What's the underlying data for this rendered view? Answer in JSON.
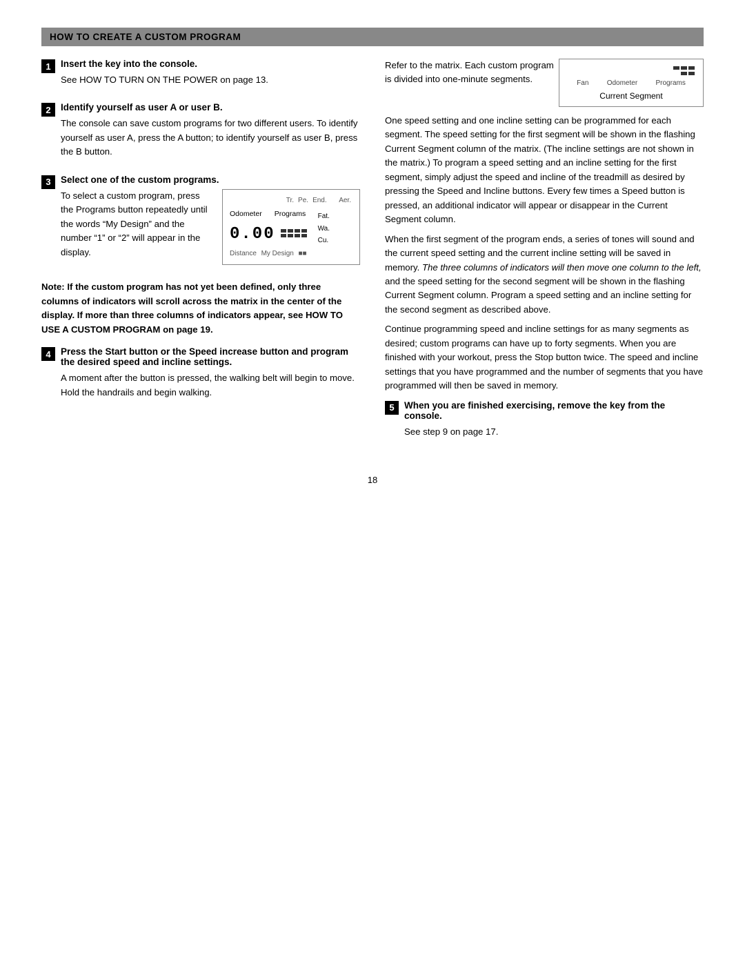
{
  "header": {
    "title": "HOW TO CREATE A CUSTOM PROGRAM"
  },
  "left_col": {
    "steps": [
      {
        "number": "1",
        "title": "Insert the key into the console.",
        "body": "See HOW TO TURN ON THE POWER on page 13."
      },
      {
        "number": "2",
        "title": "Identify yourself as user A or user B.",
        "body": "The console can save custom programs for two different users. To identify yourself as user A, press the A button; to identify yourself as user B, press the B button."
      },
      {
        "number": "3",
        "title": "Select one of the custom programs.",
        "body_intro": "To select a custom program, press the Programs button repeatedly until the words “My Design” and the number “1” or “2” will appear in the display.",
        "display": {
          "top_labels": [
            "Tr.",
            "Pe.",
            "End."
          ],
          "left_labels": [
            "Odometer",
            "Programs"
          ],
          "number": "0.00",
          "bottom_left": "Distance",
          "bottom_center": "My Design",
          "bottom_right_blocks": 2,
          "right_labels": [
            "Aer.",
            "Fat.",
            "Wa.",
            "Cu."
          ]
        }
      },
      {
        "number": "4",
        "title": "Press the Start button or the Speed increase button and program the desired speed and incline settings.",
        "body": "A moment after the button is pressed, the walking belt will begin to move. Hold the handrails and begin walking."
      }
    ],
    "note": "Note: If the custom program has not yet been defined, only three columns of indicators will scroll across the matrix in the center of the display. If more than three columns of indicators appear, see HOW TO USE A CUSTOM PROGRAM on page 19."
  },
  "right_col": {
    "intro_lines": [
      "Refer to the matrix. Each custom program is divided into one-minute segments.",
      "One speed setting and one incline setting can be programmed for each segment. The speed setting for the first segment will be shown in the flashing Current Segment column of the matrix. (The incline settings are not shown in the matrix.) To program a speed setting and an incline setting for the first segment, simply adjust the speed and incline of the treadmill as desired by pressing the Speed and Incline buttons. Every few times a Speed button is pressed, an additional indicator will appear or disappear in the Current Segment column.",
      "When the first segment of the program ends, a series of tones will sound and the current speed setting and the current incline setting will be saved in memory. The three columns of indicators will then move one column to the left, and the speed setting for the second segment will be shown in the flashing Current Segment column. Program a speed setting and an incline setting for the second segment as described above.",
      "Continue programming speed and incline settings for as many segments as desired; custom programs can have up to forty segments. When you are finished with your workout, press the Stop button twice. The speed and incline settings that you have programmed and the number of segments that you have programmed will then be saved in memory."
    ],
    "italic_phrase": "The three columns of indicators will then move one column to the left,",
    "diagram": {
      "top_labels": [
        "Fan",
        "Odometer",
        "Programs"
      ],
      "indicator_blocks": 3,
      "label": "Current Segment"
    },
    "step5": {
      "number": "5",
      "title": "When you are finished exercising, remove the key from the console.",
      "body": "See step 9 on page 17."
    }
  },
  "page_number": "18"
}
